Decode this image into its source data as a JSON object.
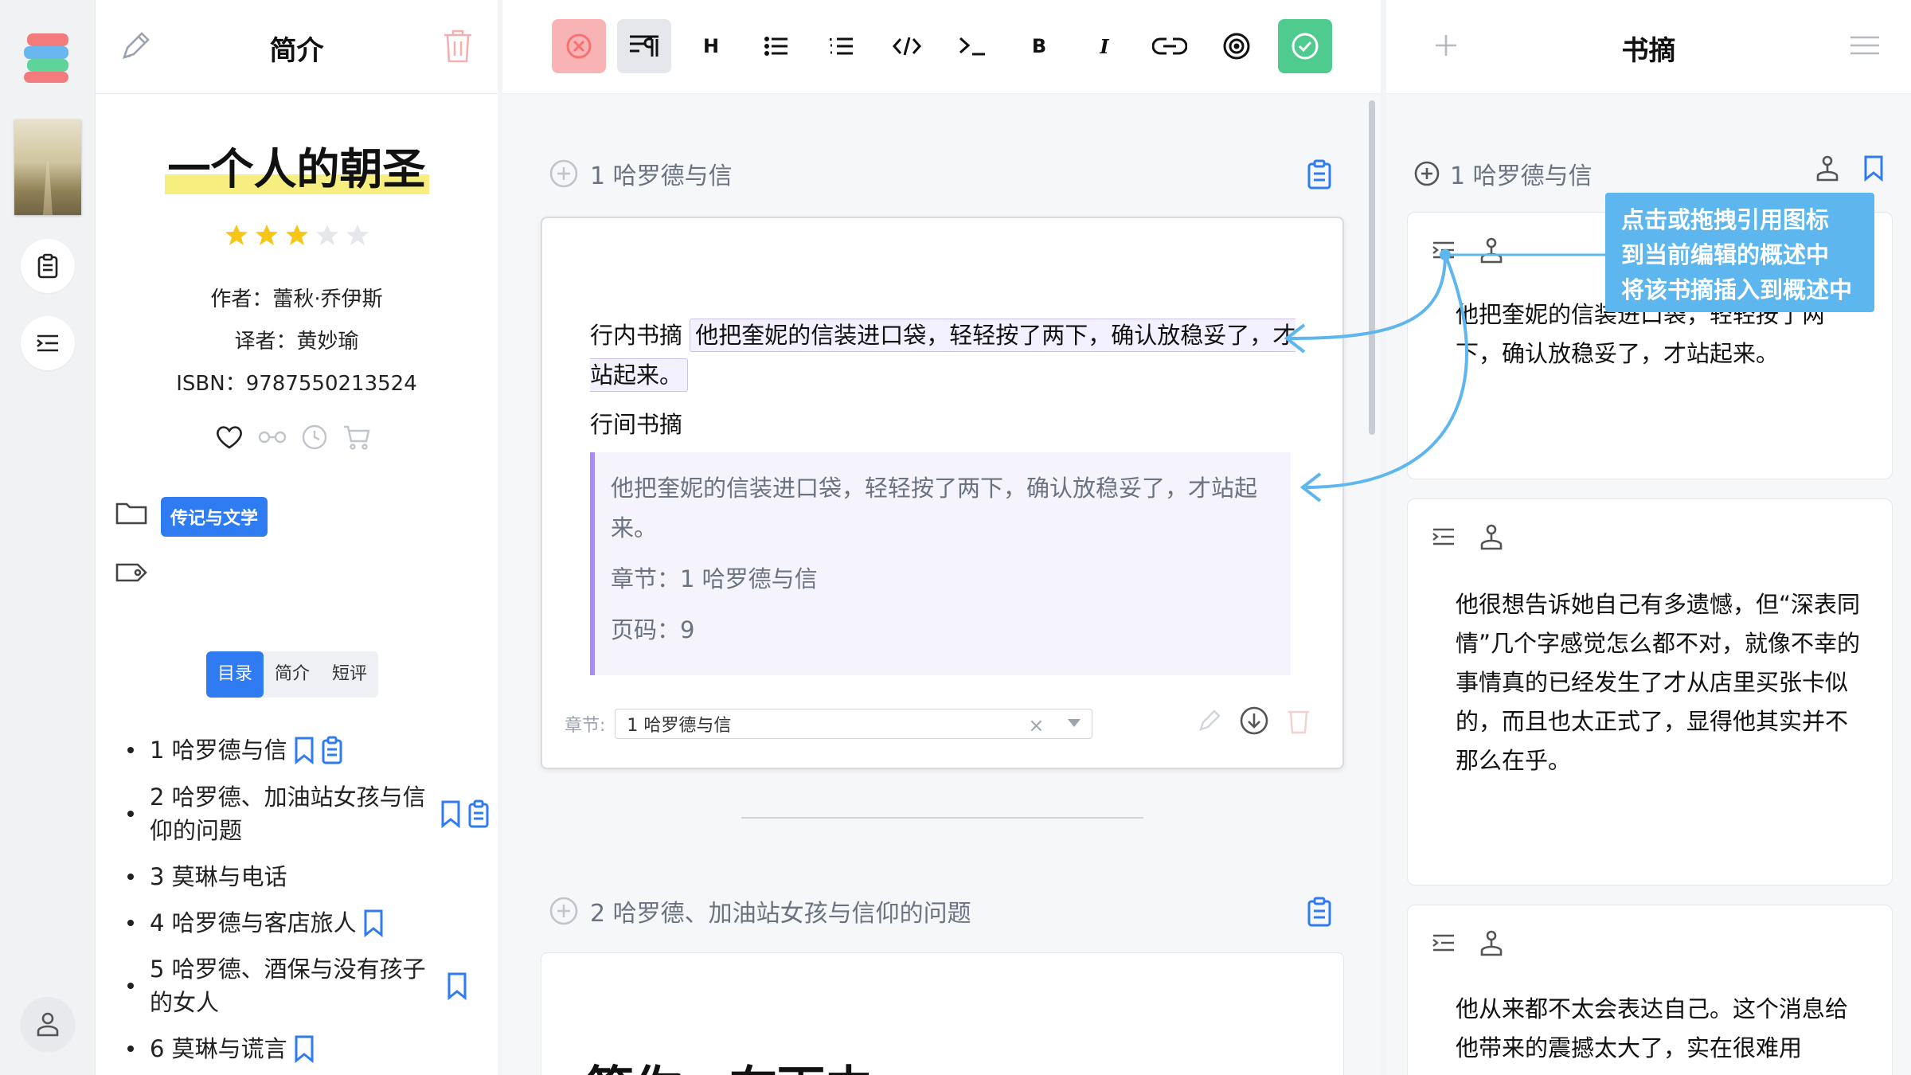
{
  "intro": {
    "title": "简介",
    "book_title": "一个人的朝圣",
    "rating": 3,
    "rating_max": 5,
    "author": "作者：蕾秋·乔伊斯",
    "translator": "译者：黄妙瑜",
    "isbn": "ISBN：9787550213524",
    "category": "传记与文学",
    "tabs": [
      {
        "label": "目录",
        "active": true
      },
      {
        "label": "简介",
        "active": false
      },
      {
        "label": "短评",
        "active": false
      }
    ],
    "toc": [
      {
        "label": "1 哈罗德与信",
        "bookmark": true,
        "excerpt": true
      },
      {
        "label": "2 哈罗德、加油站女孩与信仰的问题",
        "bookmark": true,
        "excerpt": true
      },
      {
        "label": "3 莫琳与电话",
        "bookmark": false,
        "excerpt": false
      },
      {
        "label": "4 哈罗德与客店旅人",
        "bookmark": true,
        "excerpt": false
      },
      {
        "label": "5 哈罗德、酒保与没有孩子的女人",
        "bookmark": true,
        "excerpt": false
      },
      {
        "label": "6 莫琳与谎言",
        "bookmark": true,
        "excerpt": false
      }
    ]
  },
  "toolbar": {
    "heading_label": "H",
    "bold_label": "B",
    "italic_label": "I"
  },
  "editor": {
    "section1_title": "1 哈罗德与信",
    "inline_label": "行内书摘",
    "inline_quote": "他把奎妮的信装进口袋，轻轻按了两下，确认放稳妥了，才站起来。",
    "block_label": "行间书摘",
    "block_quote_text": "他把奎妮的信装进口袋，轻轻按了两下，确认放稳妥了，才站起来。",
    "block_quote_chapter": "章节：1 哈罗德与信",
    "block_quote_page": "页码：9",
    "chapter_label": "章节:",
    "chapter_value": "1 哈罗德与信",
    "section2_title": "2 哈罗德、加油站女孩与信仰的问题",
    "section2_heading_preview": "等你，在雨中"
  },
  "excerpts": {
    "title": "书摘",
    "section_title": "1 哈罗德与信",
    "items": [
      {
        "text": "他把奎妮的信装进口袋，轻轻按了两下，确认放稳妥了，才站起来。"
      },
      {
        "text": "他很想告诉她自己有多遗憾，但“深表同情”几个字感觉怎么都不对，就像不幸的事情真的已经发生了才从店里买张卡似的，而且也太正式了，显得他其实并不那么在乎。"
      },
      {
        "text": "他从来都不太会表达自己。这个消息给他带来的震撼太大了，实在很难用"
      }
    ]
  },
  "tooltip": {
    "lines": [
      "点击或拖拽引用图标",
      "到当前编辑的概述中",
      "将该书摘插入到概述中"
    ]
  },
  "colors": {
    "accent": "#2f7bf2",
    "highlight": "#f6ef7f",
    "star": "#f5c518",
    "cancel": "#f8b4b4",
    "confirm": "#4fcb8f",
    "quote_border": "#a78bfa",
    "tooltip": "#5eb6ee"
  },
  "icons": [
    "pencil-icon",
    "trash-icon",
    "star-icon",
    "heart-icon",
    "glasses-icon",
    "clock-icon",
    "cart-icon",
    "folder-icon",
    "tag-icon",
    "bookmark-icon",
    "clipboard-icon",
    "plus-circle-icon",
    "quote-icon",
    "anchor-icon",
    "menu-icon",
    "plus-icon",
    "download-icon",
    "close-circle-icon",
    "check-circle-icon"
  ]
}
